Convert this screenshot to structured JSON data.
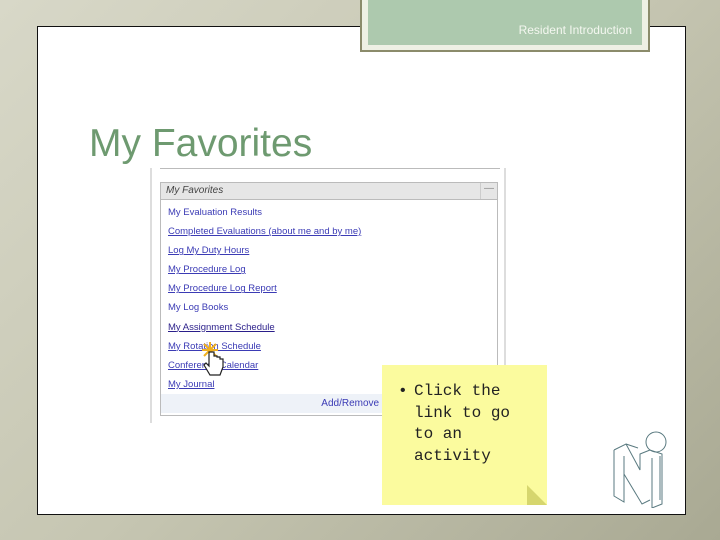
{
  "header": {
    "section": "Resident Introduction"
  },
  "slide": {
    "title": "My Favorites"
  },
  "panel": {
    "title": "My Favorites",
    "minimize": "—",
    "links": [
      {
        "label": "My Evaluation Results"
      },
      {
        "label": "Completed Evaluations (about me and by me)"
      },
      {
        "label": "Log My Duty Hours"
      },
      {
        "label": "My Procedure Log"
      },
      {
        "label": "My Procedure Log Report"
      },
      {
        "label": "My Log Books"
      },
      {
        "label": "My Assignment Schedule"
      },
      {
        "label": "My Rotation Schedule"
      },
      {
        "label": "Conference Calendar"
      },
      {
        "label": "My Journal"
      }
    ],
    "footer": "Add/Remove | Restor"
  },
  "note": {
    "bullet": "•",
    "text": "Click the link to go to an activity"
  },
  "colors": {
    "title": "#6e9a70",
    "tab": "#adc9ae",
    "note": "#fbfb9e",
    "link": "#3b3bb5"
  }
}
